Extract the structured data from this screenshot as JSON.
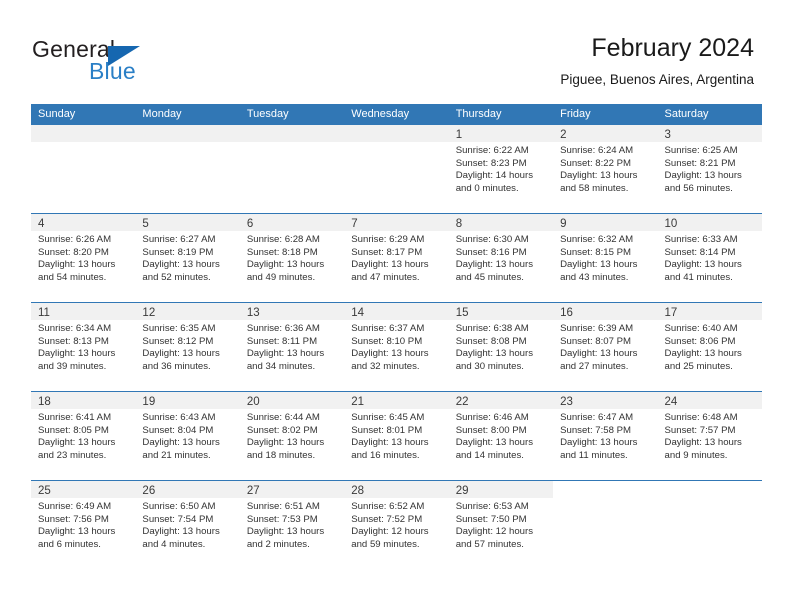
{
  "brand": {
    "name_top": "General",
    "name_bottom": "Blue"
  },
  "header": {
    "title": "February 2024",
    "subtitle": "Piguee, Buenos Aires, Argentina"
  },
  "colors": {
    "header_blue": "#3177b5",
    "logo_blue": "#2a7fc6",
    "day_band_gray": "#f1f1f1"
  },
  "weekdays": [
    "Sunday",
    "Monday",
    "Tuesday",
    "Wednesday",
    "Thursday",
    "Friday",
    "Saturday"
  ],
  "weeks": [
    [
      {
        "day": "",
        "empty": true
      },
      {
        "day": "",
        "empty": true
      },
      {
        "day": "",
        "empty": true
      },
      {
        "day": "",
        "empty": true
      },
      {
        "day": "1",
        "sunrise": "Sunrise: 6:22 AM",
        "sunset": "Sunset: 8:23 PM",
        "daylight_1": "Daylight: 14 hours",
        "daylight_2": "and 0 minutes."
      },
      {
        "day": "2",
        "sunrise": "Sunrise: 6:24 AM",
        "sunset": "Sunset: 8:22 PM",
        "daylight_1": "Daylight: 13 hours",
        "daylight_2": "and 58 minutes."
      },
      {
        "day": "3",
        "sunrise": "Sunrise: 6:25 AM",
        "sunset": "Sunset: 8:21 PM",
        "daylight_1": "Daylight: 13 hours",
        "daylight_2": "and 56 minutes."
      }
    ],
    [
      {
        "day": "4",
        "sunrise": "Sunrise: 6:26 AM",
        "sunset": "Sunset: 8:20 PM",
        "daylight_1": "Daylight: 13 hours",
        "daylight_2": "and 54 minutes."
      },
      {
        "day": "5",
        "sunrise": "Sunrise: 6:27 AM",
        "sunset": "Sunset: 8:19 PM",
        "daylight_1": "Daylight: 13 hours",
        "daylight_2": "and 52 minutes."
      },
      {
        "day": "6",
        "sunrise": "Sunrise: 6:28 AM",
        "sunset": "Sunset: 8:18 PM",
        "daylight_1": "Daylight: 13 hours",
        "daylight_2": "and 49 minutes."
      },
      {
        "day": "7",
        "sunrise": "Sunrise: 6:29 AM",
        "sunset": "Sunset: 8:17 PM",
        "daylight_1": "Daylight: 13 hours",
        "daylight_2": "and 47 minutes."
      },
      {
        "day": "8",
        "sunrise": "Sunrise: 6:30 AM",
        "sunset": "Sunset: 8:16 PM",
        "daylight_1": "Daylight: 13 hours",
        "daylight_2": "and 45 minutes."
      },
      {
        "day": "9",
        "sunrise": "Sunrise: 6:32 AM",
        "sunset": "Sunset: 8:15 PM",
        "daylight_1": "Daylight: 13 hours",
        "daylight_2": "and 43 minutes."
      },
      {
        "day": "10",
        "sunrise": "Sunrise: 6:33 AM",
        "sunset": "Sunset: 8:14 PM",
        "daylight_1": "Daylight: 13 hours",
        "daylight_2": "and 41 minutes."
      }
    ],
    [
      {
        "day": "11",
        "sunrise": "Sunrise: 6:34 AM",
        "sunset": "Sunset: 8:13 PM",
        "daylight_1": "Daylight: 13 hours",
        "daylight_2": "and 39 minutes."
      },
      {
        "day": "12",
        "sunrise": "Sunrise: 6:35 AM",
        "sunset": "Sunset: 8:12 PM",
        "daylight_1": "Daylight: 13 hours",
        "daylight_2": "and 36 minutes."
      },
      {
        "day": "13",
        "sunrise": "Sunrise: 6:36 AM",
        "sunset": "Sunset: 8:11 PM",
        "daylight_1": "Daylight: 13 hours",
        "daylight_2": "and 34 minutes."
      },
      {
        "day": "14",
        "sunrise": "Sunrise: 6:37 AM",
        "sunset": "Sunset: 8:10 PM",
        "daylight_1": "Daylight: 13 hours",
        "daylight_2": "and 32 minutes."
      },
      {
        "day": "15",
        "sunrise": "Sunrise: 6:38 AM",
        "sunset": "Sunset: 8:08 PM",
        "daylight_1": "Daylight: 13 hours",
        "daylight_2": "and 30 minutes."
      },
      {
        "day": "16",
        "sunrise": "Sunrise: 6:39 AM",
        "sunset": "Sunset: 8:07 PM",
        "daylight_1": "Daylight: 13 hours",
        "daylight_2": "and 27 minutes."
      },
      {
        "day": "17",
        "sunrise": "Sunrise: 6:40 AM",
        "sunset": "Sunset: 8:06 PM",
        "daylight_1": "Daylight: 13 hours",
        "daylight_2": "and 25 minutes."
      }
    ],
    [
      {
        "day": "18",
        "sunrise": "Sunrise: 6:41 AM",
        "sunset": "Sunset: 8:05 PM",
        "daylight_1": "Daylight: 13 hours",
        "daylight_2": "and 23 minutes."
      },
      {
        "day": "19",
        "sunrise": "Sunrise: 6:43 AM",
        "sunset": "Sunset: 8:04 PM",
        "daylight_1": "Daylight: 13 hours",
        "daylight_2": "and 21 minutes."
      },
      {
        "day": "20",
        "sunrise": "Sunrise: 6:44 AM",
        "sunset": "Sunset: 8:02 PM",
        "daylight_1": "Daylight: 13 hours",
        "daylight_2": "and 18 minutes."
      },
      {
        "day": "21",
        "sunrise": "Sunrise: 6:45 AM",
        "sunset": "Sunset: 8:01 PM",
        "daylight_1": "Daylight: 13 hours",
        "daylight_2": "and 16 minutes."
      },
      {
        "day": "22",
        "sunrise": "Sunrise: 6:46 AM",
        "sunset": "Sunset: 8:00 PM",
        "daylight_1": "Daylight: 13 hours",
        "daylight_2": "and 14 minutes."
      },
      {
        "day": "23",
        "sunrise": "Sunrise: 6:47 AM",
        "sunset": "Sunset: 7:58 PM",
        "daylight_1": "Daylight: 13 hours",
        "daylight_2": "and 11 minutes."
      },
      {
        "day": "24",
        "sunrise": "Sunrise: 6:48 AM",
        "sunset": "Sunset: 7:57 PM",
        "daylight_1": "Daylight: 13 hours",
        "daylight_2": "and 9 minutes."
      }
    ],
    [
      {
        "day": "25",
        "sunrise": "Sunrise: 6:49 AM",
        "sunset": "Sunset: 7:56 PM",
        "daylight_1": "Daylight: 13 hours",
        "daylight_2": "and 6 minutes."
      },
      {
        "day": "26",
        "sunrise": "Sunrise: 6:50 AM",
        "sunset": "Sunset: 7:54 PM",
        "daylight_1": "Daylight: 13 hours",
        "daylight_2": "and 4 minutes."
      },
      {
        "day": "27",
        "sunrise": "Sunrise: 6:51 AM",
        "sunset": "Sunset: 7:53 PM",
        "daylight_1": "Daylight: 13 hours",
        "daylight_2": "and 2 minutes."
      },
      {
        "day": "28",
        "sunrise": "Sunrise: 6:52 AM",
        "sunset": "Sunset: 7:52 PM",
        "daylight_1": "Daylight: 12 hours",
        "daylight_2": "and 59 minutes."
      },
      {
        "day": "29",
        "sunrise": "Sunrise: 6:53 AM",
        "sunset": "Sunset: 7:50 PM",
        "daylight_1": "Daylight: 12 hours",
        "daylight_2": "and 57 minutes."
      },
      {
        "day": "",
        "empty": true,
        "blank": true
      },
      {
        "day": "",
        "empty": true,
        "blank": true
      }
    ]
  ]
}
